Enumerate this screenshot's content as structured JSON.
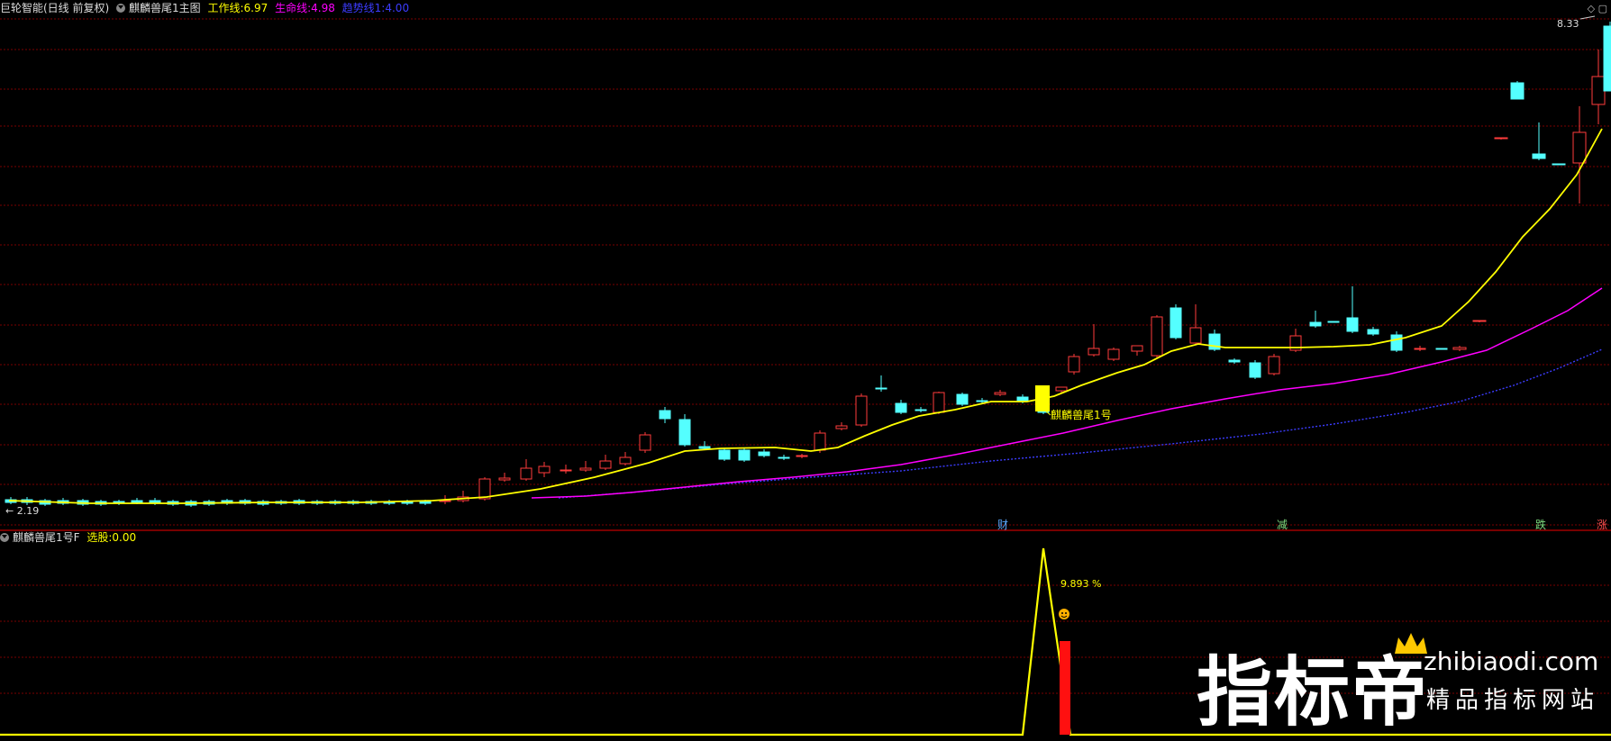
{
  "main_header": {
    "app_name": "巨轮智能(日线 前复权)",
    "indicator_name": "麒麟兽尾1主图",
    "work_line_label": "工作线:",
    "work_line_value": "6.97",
    "life_line_label": "生命线:",
    "life_line_value": "4.98",
    "trend_line_label": "趋势线1:",
    "trend_line_value": "4.00"
  },
  "price_labels": {
    "high": "8.33",
    "low": "2.19",
    "signal_text": "麒麟兽尾1号"
  },
  "event_markers": [
    {
      "text": "财",
      "color": "#5aa8ff"
    },
    {
      "text": "减",
      "color": "#7fdc7f"
    },
    {
      "text": "跌",
      "color": "#7fdc7f"
    },
    {
      "text": "涨",
      "color": "#ff5050"
    }
  ],
  "sub_header": {
    "indicator_name": "麒麟兽尾1号F",
    "select_label": "选股:",
    "select_value": "0.00"
  },
  "sub_labels": {
    "percent": "9.893 %"
  },
  "watermark": {
    "brand": "指标帝",
    "url": "zhibiaodi.com",
    "tagline": "精品指标网站"
  },
  "colors": {
    "work_line": "#ffff00",
    "life_line": "#ff00ff",
    "trend_line": "#3c3cff",
    "up_candle": "#ff3c3c",
    "down_candle": "#54ffff",
    "grid": "#8a0000",
    "divider": "#c00000"
  }
}
